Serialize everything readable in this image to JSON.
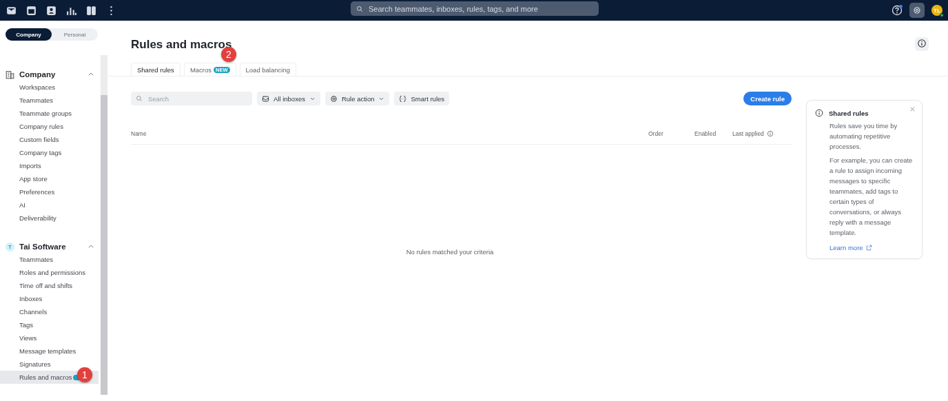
{
  "top_bar": {
    "search": {
      "placeholder": "Search teammates, inboxes, rules, tags, and more"
    },
    "avatar": {
      "initials": "TL"
    },
    "help_notification": true
  },
  "sidebar": {
    "scope_tabs": [
      {
        "label": "Company",
        "selected": true
      },
      {
        "label": "Personal",
        "selected": false
      }
    ],
    "sections": [
      {
        "title": "Company",
        "kind": "company",
        "expanded": true,
        "items": [
          {
            "label": "Workspaces",
            "selected": false
          },
          {
            "label": "Teammates",
            "selected": false
          },
          {
            "label": "Teammate groups",
            "selected": false
          },
          {
            "label": "Company rules",
            "selected": false
          },
          {
            "label": "Custom fields",
            "selected": false
          },
          {
            "label": "Company tags",
            "selected": false
          },
          {
            "label": "Imports",
            "selected": false
          },
          {
            "label": "App store",
            "selected": false
          },
          {
            "label": "Preferences",
            "selected": false
          },
          {
            "label": "AI",
            "selected": false
          },
          {
            "label": "Deliverability",
            "selected": false
          }
        ]
      },
      {
        "title": "Tai Software",
        "kind": "workspace",
        "avatar": "T",
        "expanded": true,
        "items": [
          {
            "label": "Teammates",
            "selected": false
          },
          {
            "label": "Roles and permissions",
            "selected": false
          },
          {
            "label": "Time off and shifts",
            "selected": false
          },
          {
            "label": "Inboxes",
            "selected": false
          },
          {
            "label": "Channels",
            "selected": false
          },
          {
            "label": "Tags",
            "selected": false
          },
          {
            "label": "Views",
            "selected": false
          },
          {
            "label": "Message templates",
            "selected": false
          },
          {
            "label": "Signatures",
            "selected": false
          },
          {
            "label": "Rules and macros",
            "selected": true,
            "new_badge": true,
            "callout": "1"
          }
        ]
      }
    ]
  },
  "page": {
    "title": "Rules and macros",
    "tabs": [
      {
        "label": "Shared rules",
        "selected": true
      },
      {
        "label": "Macros",
        "selected": false,
        "badge": "NEW",
        "callout": "2"
      },
      {
        "label": "Load balancing",
        "selected": false
      }
    ],
    "search": {
      "placeholder": "Search"
    },
    "filters": [
      {
        "label": "All inboxes",
        "kind": "inbox",
        "dropdown": true
      },
      {
        "label": "Rule action",
        "kind": "gear",
        "dropdown": true
      },
      {
        "label": "Smart rules",
        "kind": "braces",
        "dropdown": false
      }
    ],
    "create_button": "Create rule",
    "table": {
      "columns": [
        "Name",
        "Order",
        "Enabled",
        "Last applied"
      ],
      "empty_message": "No rules matched your criteria"
    },
    "info_card": {
      "title": "Shared rules",
      "paragraphs": [
        "Rules save you time by automating repetitive processes.",
        "For example, you can create a rule to assign incoming messages to specific teammates, add tags to certain types of conversations, or always reply with a message template."
      ],
      "link": "Learn more"
    }
  }
}
